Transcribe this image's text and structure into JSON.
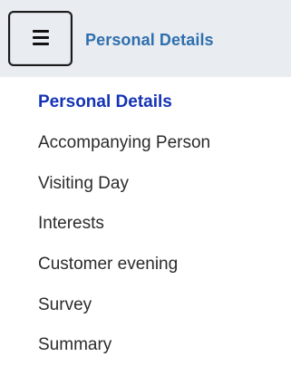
{
  "header": {
    "menu_icon": "hamburger-menu-icon",
    "title": "Personal Details",
    "title_color": "#2f6fae",
    "bar_color": "#e9edf1"
  },
  "menu": {
    "active_color": "#1433b5",
    "text_color": "#2b2b2b",
    "items": [
      {
        "label": "Personal Details",
        "active": true
      },
      {
        "label": "Accompanying Person",
        "active": false
      },
      {
        "label": "Visiting Day",
        "active": false
      },
      {
        "label": "Interests",
        "active": false
      },
      {
        "label": "Customer evening",
        "active": false
      },
      {
        "label": "Survey",
        "active": false
      },
      {
        "label": "Summary",
        "active": false
      }
    ]
  }
}
